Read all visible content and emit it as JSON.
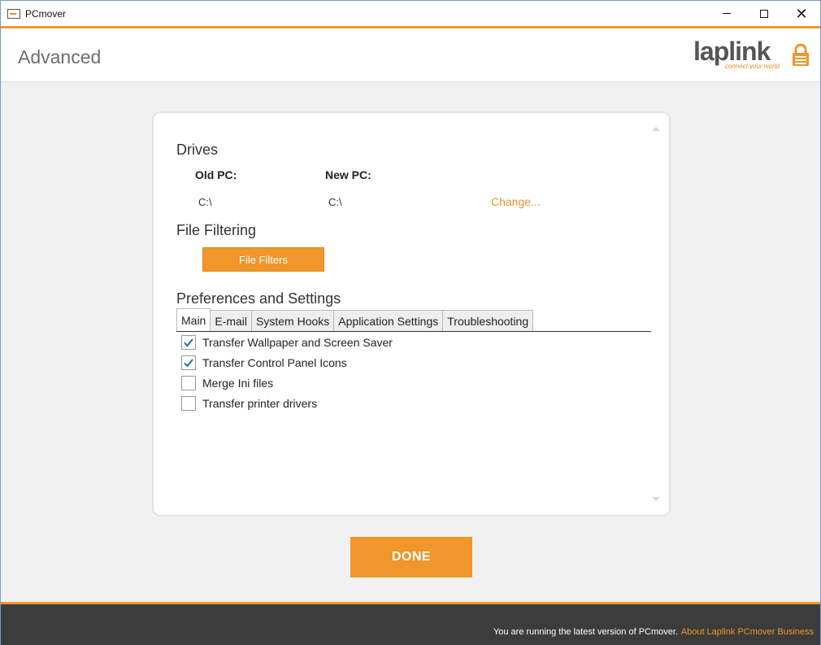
{
  "window": {
    "title": "PCmover",
    "controls": {
      "minimize": "minimize-icon",
      "maximize": "maximize-icon",
      "close": "close-icon"
    }
  },
  "header": {
    "title": "Advanced",
    "logo_text": "laplink",
    "logo_tagline": "connect your world",
    "lock_icon": "lock-icon"
  },
  "drives": {
    "title": "Drives",
    "old_pc_label": "Old PC:",
    "new_pc_label": "New PC:",
    "old_pc_drive": "C:\\",
    "new_pc_drive": "C:\\",
    "change_link": "Change..."
  },
  "file_filtering": {
    "title": "File Filtering",
    "button_label": "File Filters"
  },
  "preferences": {
    "title": "Preferences and Settings",
    "tabs": [
      {
        "label": "Main",
        "active": true
      },
      {
        "label": "E-mail",
        "active": false
      },
      {
        "label": "System Hooks",
        "active": false
      },
      {
        "label": "Application Settings",
        "active": false
      },
      {
        "label": "Troubleshooting",
        "active": false
      }
    ],
    "options": [
      {
        "label": "Transfer Wallpaper and Screen Saver",
        "checked": true
      },
      {
        "label": "Transfer Control Panel Icons",
        "checked": true
      },
      {
        "label": "Merge Ini files",
        "checked": false
      },
      {
        "label": "Transfer printer drivers",
        "checked": false
      }
    ]
  },
  "done_button": "DONE",
  "footer": {
    "status": "You are running the latest version of PCmover.",
    "about_link": "About Laplink PCmover Business"
  },
  "colors": {
    "accent": "#f0962b",
    "footer_bg": "#3c3c3c",
    "check_color": "#1f6fb2"
  }
}
